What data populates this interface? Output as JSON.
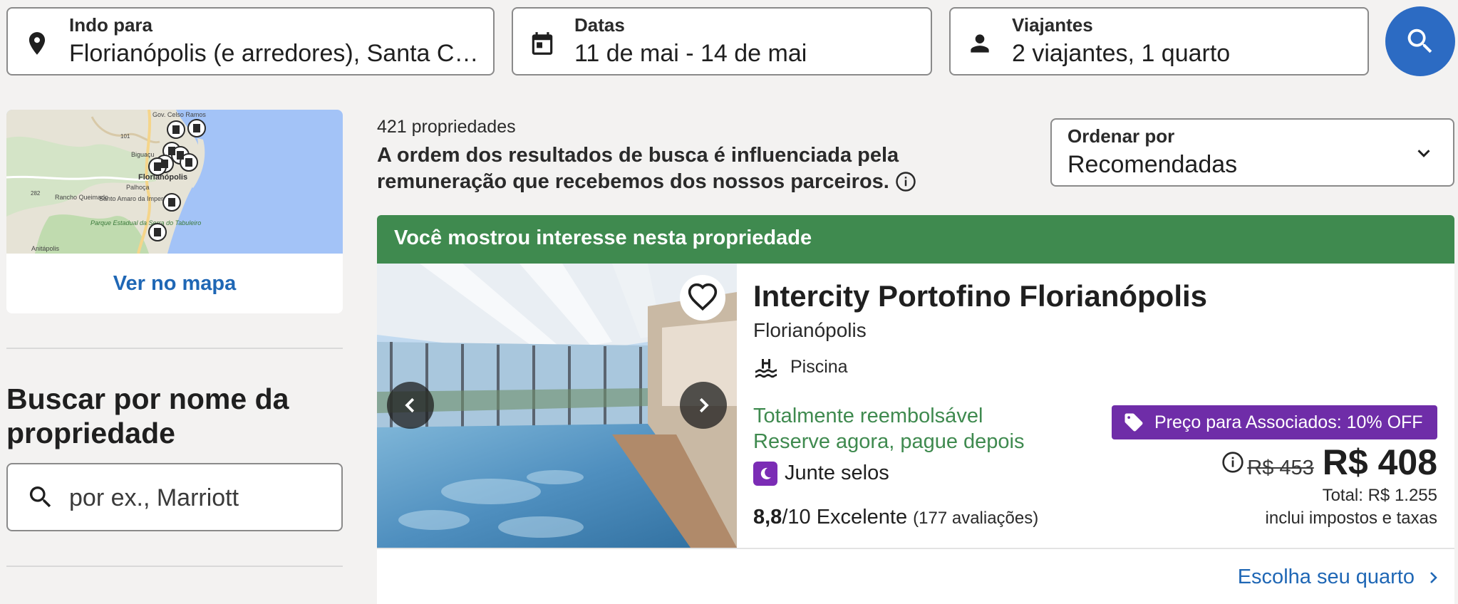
{
  "search": {
    "destination": {
      "label": "Indo para",
      "value": "Florianópolis (e arredores), Santa Catarina, Brasil",
      "icon": "map-pin-icon"
    },
    "dates": {
      "label": "Datas",
      "value": "11 de mai - 14 de mai",
      "icon": "calendar-icon"
    },
    "travelers": {
      "label": "Viajantes",
      "value": "2 viajantes, 1 quarto",
      "icon": "person-icon"
    },
    "button_icon": "search-icon"
  },
  "sidebar": {
    "map_labels": [
      "Gov. Celso Ramos",
      "Biguaçu",
      "Florianópolis",
      "Palhoça",
      "Rancho Queimado",
      "Santo Amaro da Imperatriz",
      "Parque Estadual da Serra do Tabuleiro",
      "Anitápolis",
      "282",
      "101"
    ],
    "map_link": "Ver no mapa",
    "name_search_title": "Buscar por nome da propriedade",
    "name_search_placeholder": "por ex., Marriott"
  },
  "results": {
    "count": "421 propriedades",
    "disclaimer": "A ordem dos resultados de busca é influenciada pela remuneração que recebemos dos nossos parceiros.",
    "sort": {
      "label": "Ordenar por",
      "value": "Recomendadas"
    }
  },
  "property": {
    "banner": "Você mostrou interesse nesta propriedade",
    "name": "Intercity Portofino Florianópolis",
    "city": "Florianópolis",
    "amenity": "Piscina",
    "refundable": "Totalmente reembolsável",
    "pay_later": "Reserve agora, pague depois",
    "stamps": "Junte selos",
    "rating_score": "8,8",
    "rating_scale": "/10",
    "rating_label": "Excelente",
    "reviews": "(177 avaliações)",
    "member_badge": "Preço para Associados: 10% OFF",
    "old_price": "R$ 453",
    "price": "R$ 408",
    "total": "Total: R$ 1.255",
    "taxes": "inclui impostos e taxas",
    "choose_room": "Escolha seu quarto"
  },
  "colors": {
    "accent_blue": "#2c6bc3",
    "link_blue": "#1f67b5",
    "green": "#3f8a4f",
    "purple": "#6f2da8",
    "background": "#f3f2f1"
  }
}
